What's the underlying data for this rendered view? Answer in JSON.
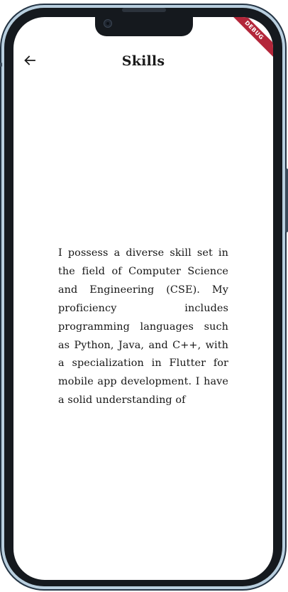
{
  "debug_banner": {
    "label": "DEBUG"
  },
  "app_bar": {
    "back_icon": "arrow-left-icon",
    "title": "Skills"
  },
  "content": {
    "paragraph": "I possess a diverse skill set in the field of Computer Science and Engineering (CSE). My proficiency includes programming languages such as Python, Java, and C++, with a specialization in Flutter for mobile app development. I have a solid understanding of"
  },
  "colors": {
    "frame": "#b9cfdf",
    "bezel": "#15191e",
    "screen": "#ffffff",
    "text": "#161616",
    "debug_ribbon": "#b3263a"
  }
}
